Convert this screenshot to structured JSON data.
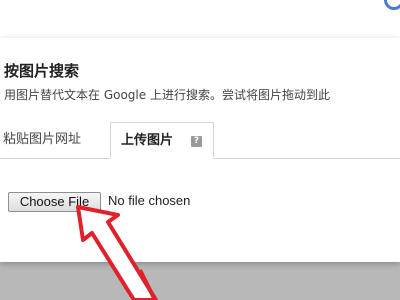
{
  "dialog": {
    "title": "按图片搜索",
    "subtitle": "用图片替代文本在 Google 上进行搜索。尝试将图片拖动到此"
  },
  "tabs": [
    {
      "label": "粘贴图片网址"
    },
    {
      "label": "上传图片",
      "help_icon": "help-icon"
    }
  ],
  "upload": {
    "button_label": "Choose File",
    "status_text": "No file chosen"
  },
  "annotation": {
    "icon": "red-arrow-icon",
    "color": "#e0202a"
  }
}
